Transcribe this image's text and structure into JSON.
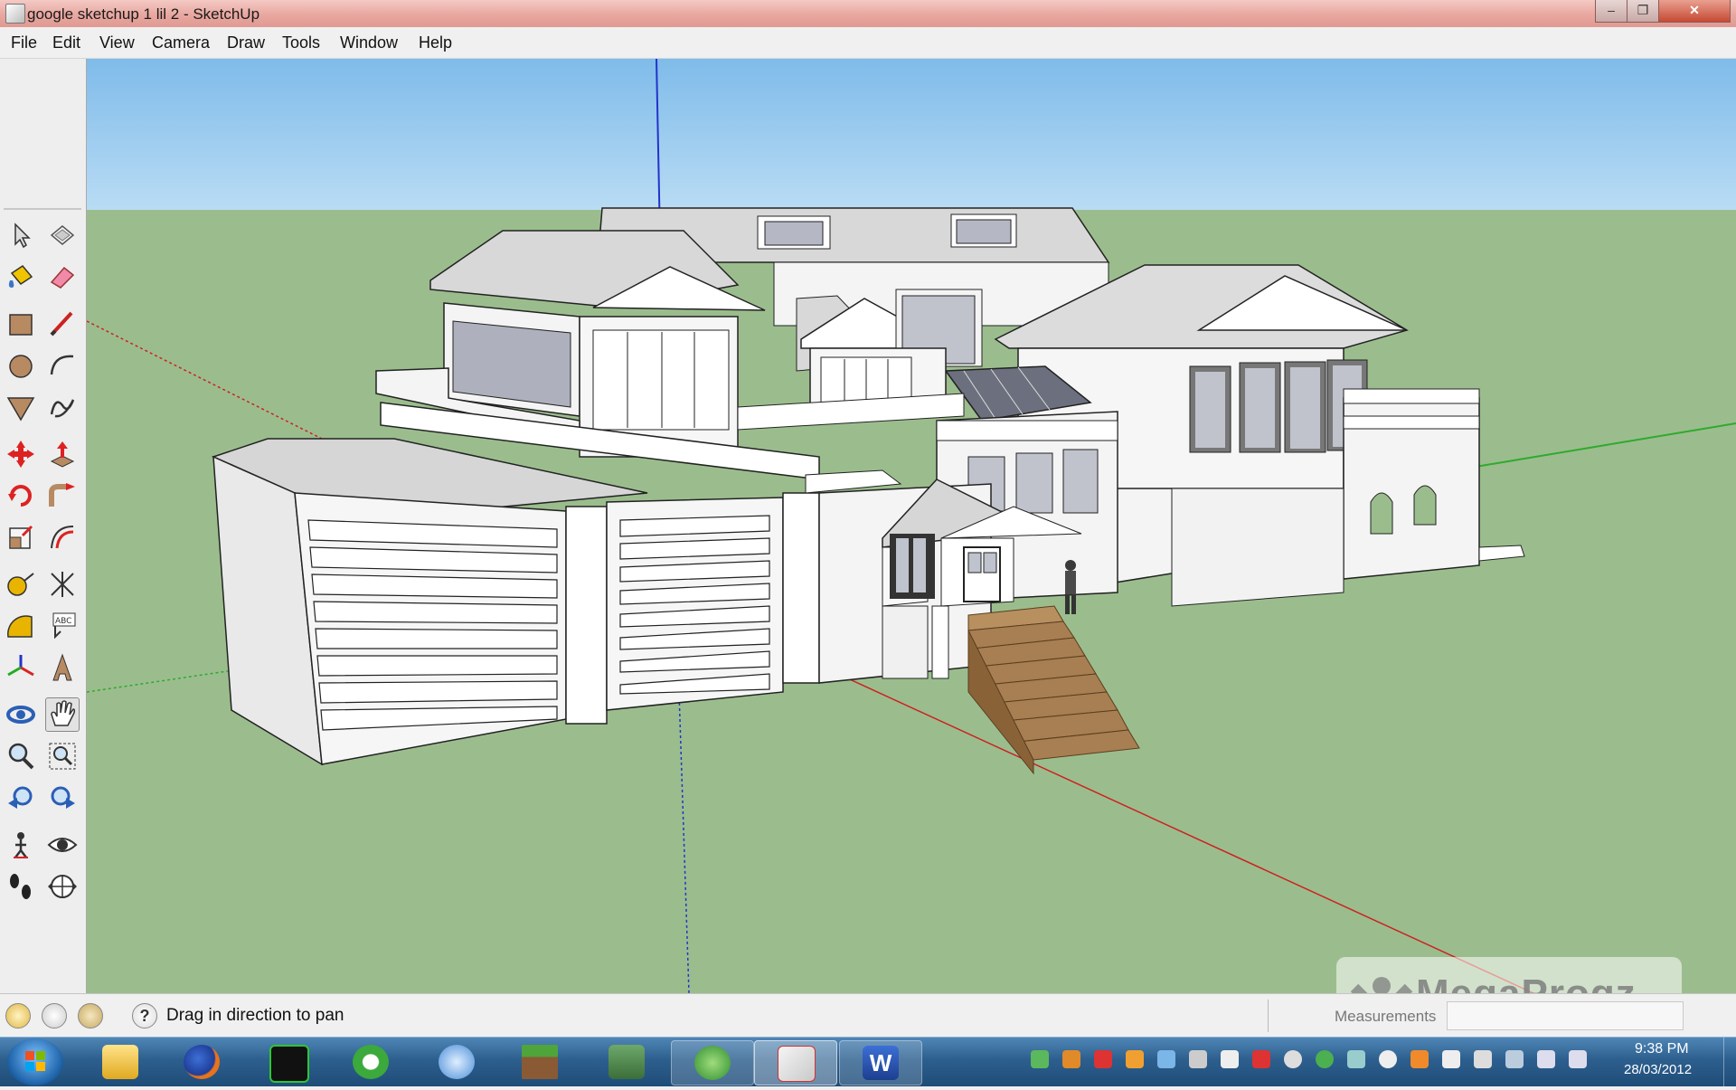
{
  "window": {
    "title": "google sketchup 1 lil 2 - SketchUp",
    "controls": {
      "minimize": "–",
      "maximize": "❐",
      "close": "✕"
    }
  },
  "menu": [
    "File",
    "Edit",
    "View",
    "Camera",
    "Draw",
    "Tools",
    "Window",
    "Help"
  ],
  "toolbar": {
    "tools": [
      "select",
      "make-component",
      "paint-bucket",
      "eraser",
      "rectangle",
      "line",
      "circle",
      "arc",
      "polygon",
      "freehand",
      "move",
      "push-pull",
      "rotate",
      "follow-me",
      "scale",
      "offset",
      "tape-measure",
      "dimension",
      "protractor",
      "text",
      "axes",
      "3d-text",
      "orbit",
      "pan",
      "zoom",
      "zoom-window",
      "previous-view",
      "next-view",
      "position-camera",
      "look-around",
      "walk",
      "section-plane"
    ],
    "active_tool": "pan"
  },
  "status": {
    "hint": "Drag in direction to pan",
    "help_icon": "?",
    "measurements_label": "Measurements",
    "measurements_value": ""
  },
  "watermark": "MegaProgz",
  "scene": {
    "sky_color": "#8fc3ea",
    "ground_color": "#9bbd8d",
    "axis_colors": {
      "red": "#cc2222",
      "green": "#2eaa2e",
      "blue": "#2233cc"
    }
  },
  "taskbar": {
    "apps": [
      "windows-explorer",
      "firefox",
      "sketchup-4",
      "utorrent",
      "itunes",
      "minecraft",
      "network-monitor",
      "messenger",
      "sketchup",
      "word"
    ],
    "clock_time": "9:38 PM",
    "clock_date": "28/03/2012"
  }
}
